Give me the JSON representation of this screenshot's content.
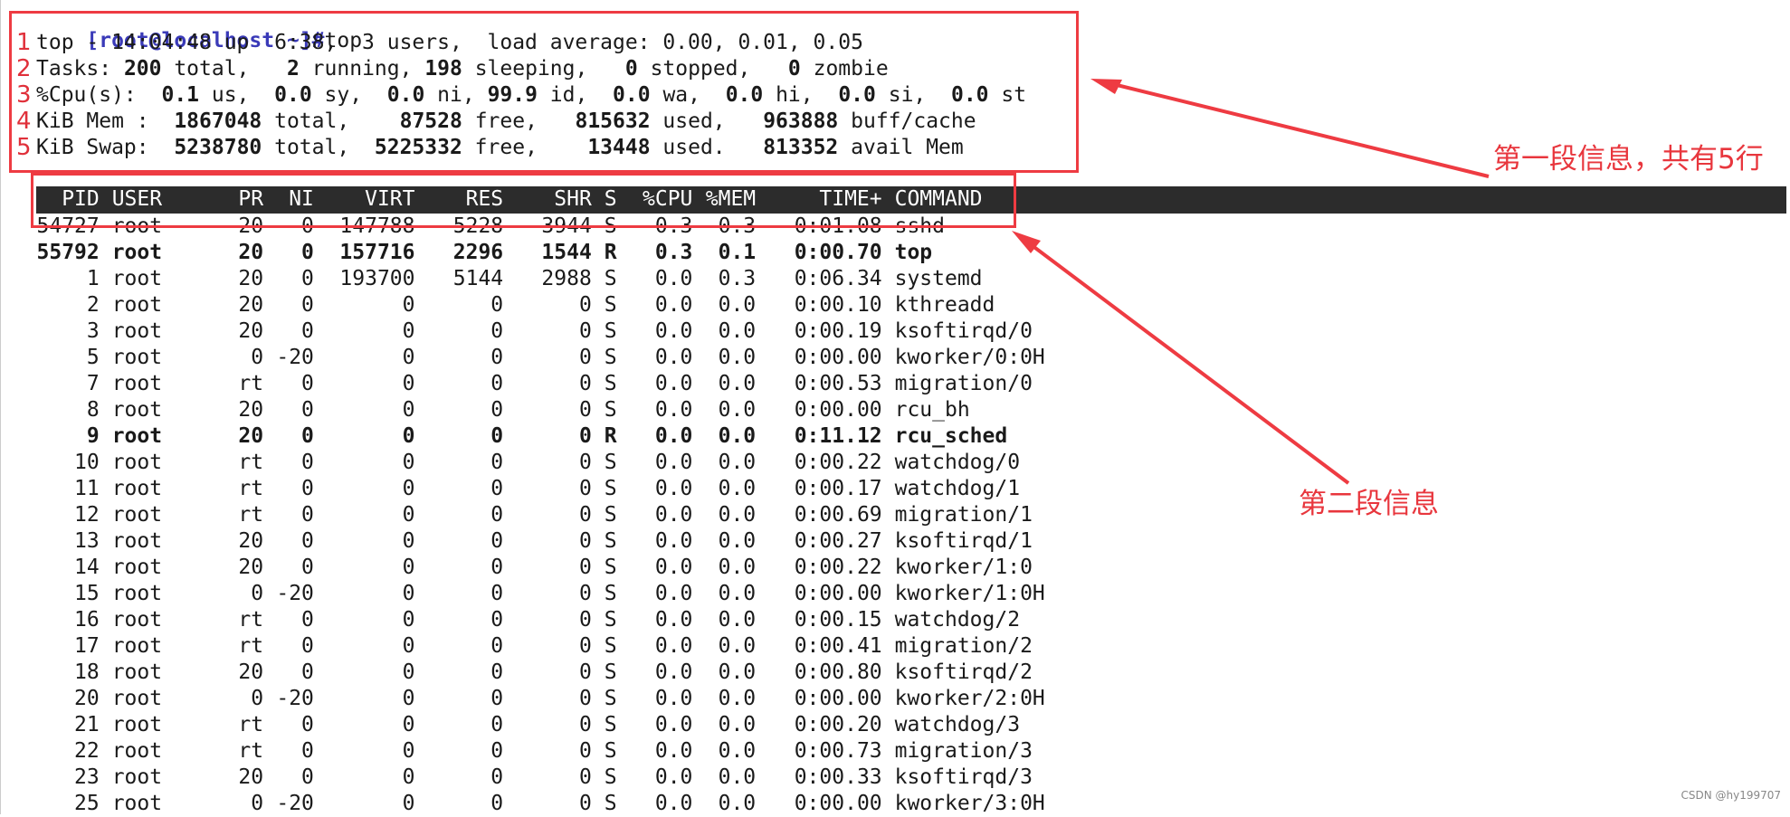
{
  "prompt": {
    "user_host": "[root@localhost ~]#",
    "command": "top"
  },
  "summary": {
    "line1": "top - 14:04:48 up  6:38,  3 users,  load average: 0.00, 0.01, 0.05",
    "tasks": {
      "label": "Tasks: ",
      "total": "200",
      "t_total": " total,   ",
      "running": "2",
      "t_running": " running, ",
      "sleeping": "198",
      "t_sleeping": " sleeping,   ",
      "stopped": "0",
      "t_stopped": " stopped,   ",
      "zombie": "0",
      "t_zombie": " zombie"
    },
    "cpu": {
      "label": "%Cpu(s):  ",
      "us": "0.1",
      "t_us": " us,  ",
      "sy": "0.0",
      "t_sy": " sy,  ",
      "ni": "0.0",
      "t_ni": " ni, ",
      "id": "99.9",
      "t_id": " id,  ",
      "wa": "0.0",
      "t_wa": " wa,  ",
      "hi": "0.0",
      "t_hi": " hi,  ",
      "si": "0.0",
      "t_si": " si,  ",
      "st": "0.0",
      "t_st": " st"
    },
    "mem": {
      "label": "KiB Mem :  ",
      "total": "1867048",
      "t_total": " total,    ",
      "free": "87528",
      "t_free": " free,   ",
      "used": "815632",
      "t_used": " used,   ",
      "buff": "963888",
      "t_buff": " buff/cache"
    },
    "swap": {
      "label": "KiB Swap:  ",
      "total": "5238780",
      "t_total": " total,  ",
      "free": "5225332",
      "t_free": " free,    ",
      "used": "13448",
      "t_used": " used.   ",
      "avail": "813352",
      "t_avail": " avail Mem"
    }
  },
  "row_numbers": [
    "1",
    "2",
    "3",
    "4",
    "5"
  ],
  "table": {
    "columns": [
      "PID",
      "USER",
      "PR",
      "NI",
      "VIRT",
      "RES",
      "SHR",
      "S",
      "%CPU",
      "%MEM",
      "TIME+",
      "COMMAND"
    ],
    "rows": [
      {
        "pid": "54727",
        "user": "root",
        "pr": "20",
        "ni": "0",
        "virt": "147788",
        "res": "5228",
        "shr": "3944",
        "s": "S",
        "cpu": "0.3",
        "mem": "0.3",
        "time": "0:01.08",
        "cmd": "sshd",
        "bold": false
      },
      {
        "pid": "55792",
        "user": "root",
        "pr": "20",
        "ni": "0",
        "virt": "157716",
        "res": "2296",
        "shr": "1544",
        "s": "R",
        "cpu": "0.3",
        "mem": "0.1",
        "time": "0:00.70",
        "cmd": "top",
        "bold": true
      },
      {
        "pid": "1",
        "user": "root",
        "pr": "20",
        "ni": "0",
        "virt": "193700",
        "res": "5144",
        "shr": "2988",
        "s": "S",
        "cpu": "0.0",
        "mem": "0.3",
        "time": "0:06.34",
        "cmd": "systemd",
        "bold": false
      },
      {
        "pid": "2",
        "user": "root",
        "pr": "20",
        "ni": "0",
        "virt": "0",
        "res": "0",
        "shr": "0",
        "s": "S",
        "cpu": "0.0",
        "mem": "0.0",
        "time": "0:00.10",
        "cmd": "kthreadd",
        "bold": false
      },
      {
        "pid": "3",
        "user": "root",
        "pr": "20",
        "ni": "0",
        "virt": "0",
        "res": "0",
        "shr": "0",
        "s": "S",
        "cpu": "0.0",
        "mem": "0.0",
        "time": "0:00.19",
        "cmd": "ksoftirqd/0",
        "bold": false
      },
      {
        "pid": "5",
        "user": "root",
        "pr": "0",
        "ni": "-20",
        "virt": "0",
        "res": "0",
        "shr": "0",
        "s": "S",
        "cpu": "0.0",
        "mem": "0.0",
        "time": "0:00.00",
        "cmd": "kworker/0:0H",
        "bold": false
      },
      {
        "pid": "7",
        "user": "root",
        "pr": "rt",
        "ni": "0",
        "virt": "0",
        "res": "0",
        "shr": "0",
        "s": "S",
        "cpu": "0.0",
        "mem": "0.0",
        "time": "0:00.53",
        "cmd": "migration/0",
        "bold": false
      },
      {
        "pid": "8",
        "user": "root",
        "pr": "20",
        "ni": "0",
        "virt": "0",
        "res": "0",
        "shr": "0",
        "s": "S",
        "cpu": "0.0",
        "mem": "0.0",
        "time": "0:00.00",
        "cmd": "rcu_bh",
        "bold": false
      },
      {
        "pid": "9",
        "user": "root",
        "pr": "20",
        "ni": "0",
        "virt": "0",
        "res": "0",
        "shr": "0",
        "s": "R",
        "cpu": "0.0",
        "mem": "0.0",
        "time": "0:11.12",
        "cmd": "rcu_sched",
        "bold": true
      },
      {
        "pid": "10",
        "user": "root",
        "pr": "rt",
        "ni": "0",
        "virt": "0",
        "res": "0",
        "shr": "0",
        "s": "S",
        "cpu": "0.0",
        "mem": "0.0",
        "time": "0:00.22",
        "cmd": "watchdog/0",
        "bold": false
      },
      {
        "pid": "11",
        "user": "root",
        "pr": "rt",
        "ni": "0",
        "virt": "0",
        "res": "0",
        "shr": "0",
        "s": "S",
        "cpu": "0.0",
        "mem": "0.0",
        "time": "0:00.17",
        "cmd": "watchdog/1",
        "bold": false
      },
      {
        "pid": "12",
        "user": "root",
        "pr": "rt",
        "ni": "0",
        "virt": "0",
        "res": "0",
        "shr": "0",
        "s": "S",
        "cpu": "0.0",
        "mem": "0.0",
        "time": "0:00.69",
        "cmd": "migration/1",
        "bold": false
      },
      {
        "pid": "13",
        "user": "root",
        "pr": "20",
        "ni": "0",
        "virt": "0",
        "res": "0",
        "shr": "0",
        "s": "S",
        "cpu": "0.0",
        "mem": "0.0",
        "time": "0:00.27",
        "cmd": "ksoftirqd/1",
        "bold": false
      },
      {
        "pid": "14",
        "user": "root",
        "pr": "20",
        "ni": "0",
        "virt": "0",
        "res": "0",
        "shr": "0",
        "s": "S",
        "cpu": "0.0",
        "mem": "0.0",
        "time": "0:00.22",
        "cmd": "kworker/1:0",
        "bold": false
      },
      {
        "pid": "15",
        "user": "root",
        "pr": "0",
        "ni": "-20",
        "virt": "0",
        "res": "0",
        "shr": "0",
        "s": "S",
        "cpu": "0.0",
        "mem": "0.0",
        "time": "0:00.00",
        "cmd": "kworker/1:0H",
        "bold": false
      },
      {
        "pid": "16",
        "user": "root",
        "pr": "rt",
        "ni": "0",
        "virt": "0",
        "res": "0",
        "shr": "0",
        "s": "S",
        "cpu": "0.0",
        "mem": "0.0",
        "time": "0:00.15",
        "cmd": "watchdog/2",
        "bold": false
      },
      {
        "pid": "17",
        "user": "root",
        "pr": "rt",
        "ni": "0",
        "virt": "0",
        "res": "0",
        "shr": "0",
        "s": "S",
        "cpu": "0.0",
        "mem": "0.0",
        "time": "0:00.41",
        "cmd": "migration/2",
        "bold": false
      },
      {
        "pid": "18",
        "user": "root",
        "pr": "20",
        "ni": "0",
        "virt": "0",
        "res": "0",
        "shr": "0",
        "s": "S",
        "cpu": "0.0",
        "mem": "0.0",
        "time": "0:00.80",
        "cmd": "ksoftirqd/2",
        "bold": false
      },
      {
        "pid": "20",
        "user": "root",
        "pr": "0",
        "ni": "-20",
        "virt": "0",
        "res": "0",
        "shr": "0",
        "s": "S",
        "cpu": "0.0",
        "mem": "0.0",
        "time": "0:00.00",
        "cmd": "kworker/2:0H",
        "bold": false
      },
      {
        "pid": "21",
        "user": "root",
        "pr": "rt",
        "ni": "0",
        "virt": "0",
        "res": "0",
        "shr": "0",
        "s": "S",
        "cpu": "0.0",
        "mem": "0.0",
        "time": "0:00.20",
        "cmd": "watchdog/3",
        "bold": false
      },
      {
        "pid": "22",
        "user": "root",
        "pr": "rt",
        "ni": "0",
        "virt": "0",
        "res": "0",
        "shr": "0",
        "s": "S",
        "cpu": "0.0",
        "mem": "0.0",
        "time": "0:00.73",
        "cmd": "migration/3",
        "bold": false
      },
      {
        "pid": "23",
        "user": "root",
        "pr": "20",
        "ni": "0",
        "virt": "0",
        "res": "0",
        "shr": "0",
        "s": "S",
        "cpu": "0.0",
        "mem": "0.0",
        "time": "0:00.33",
        "cmd": "ksoftirqd/3",
        "bold": false
      },
      {
        "pid": "25",
        "user": "root",
        "pr": "0",
        "ni": "-20",
        "virt": "0",
        "res": "0",
        "shr": "0",
        "s": "S",
        "cpu": "0.0",
        "mem": "0.0",
        "time": "0:00.00",
        "cmd": "kworker/3:0H",
        "bold": false
      }
    ]
  },
  "annotations": {
    "section1": "第一段信息，共有5行",
    "section2": "第二段信息",
    "color": "#e8363d"
  },
  "watermark": "CSDN @hy199707"
}
